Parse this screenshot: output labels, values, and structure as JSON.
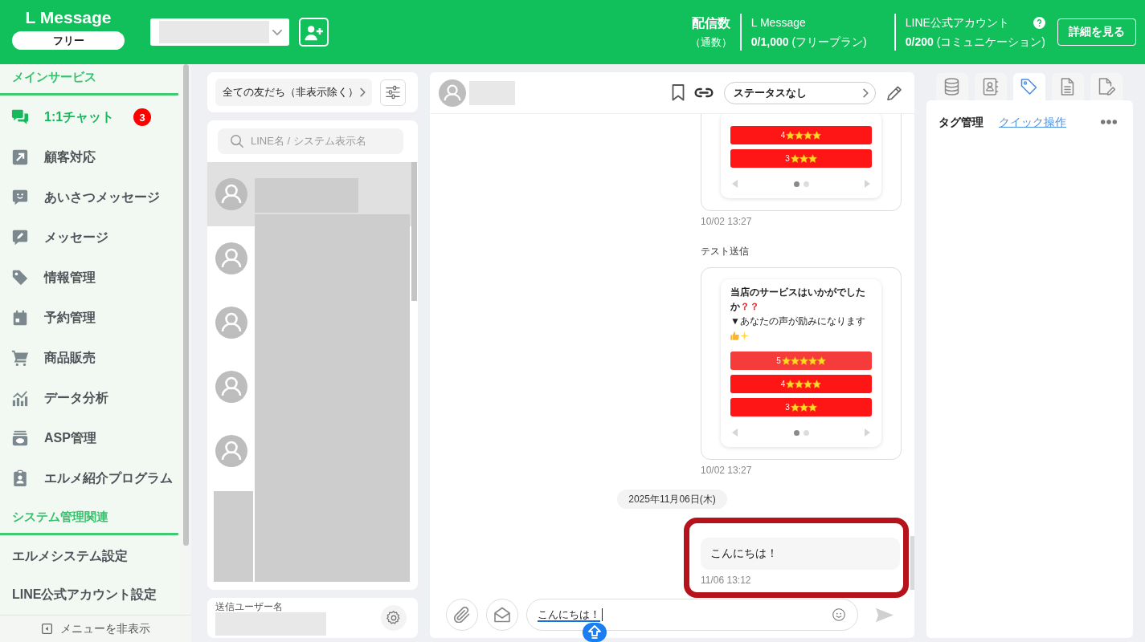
{
  "header": {
    "logo": "L Message",
    "plan": "フリー",
    "stats": {
      "title": "配信数",
      "subtitle": "（通数）"
    },
    "counters": [
      {
        "title": "L Message",
        "usage": "**0/1,000** (フリープラン)",
        "help": false
      },
      {
        "title": "LINE公式アカウント",
        "usage": "**0/200** (コミュニケーション)",
        "help": true
      }
    ],
    "details_button": "詳細を見る"
  },
  "sidebar": {
    "sections": [
      {
        "title": "メインサービス",
        "items": [
          {
            "label": "1:1チャット",
            "selected": true,
            "badge": "3"
          },
          {
            "label": "顧客対応",
            "selected": false
          },
          {
            "label": "あいさつメッセージ",
            "selected": false
          },
          {
            "label": "メッセージ",
            "selected": false
          },
          {
            "label": "情報管理",
            "selected": false
          },
          {
            "label": "予約管理",
            "selected": false
          },
          {
            "label": "商品販売",
            "selected": false
          },
          {
            "label": "データ分析",
            "selected": false
          },
          {
            "label": "ASP管理",
            "selected": false
          },
          {
            "label": "エルメ紹介プログラム",
            "selected": false
          }
        ]
      },
      {
        "title": "システム管理関連",
        "items": [
          {
            "label": "エルメシステム設定",
            "selected": false
          },
          {
            "label": "LINE公式アカウント設定",
            "selected": false
          }
        ]
      }
    ],
    "hide_menu": "メニューを非表示"
  },
  "friends_panel": {
    "filter": "全ての友だち（非表示除く）",
    "search": {
      "placeholder": "LINE名 / システム表示名"
    },
    "friends": [
      {
        "selected": true
      },
      {
        "selected": false
      },
      {
        "selected": false
      },
      {
        "selected": false
      },
      {
        "selected": false
      }
    ],
    "sender": {
      "label": "送信ユーザー名"
    }
  },
  "chat": {
    "status": "ステータスなし",
    "messages": [
      {
        "kind": "card",
        "buttons": [
          {
            "label": "4",
            "stars": 4,
            "color": "#fe1515"
          },
          {
            "label": "3",
            "stars": 3,
            "color": "#fe1515"
          }
        ],
        "pages": [
          {
            "selected": true
          },
          {
            "selected": false
          }
        ],
        "time": "10/02 13:27"
      },
      {
        "kind": "card",
        "caption": "テスト送信",
        "title": "当店のサービスはいかがでしたか",
        "title_emphasis": "？？",
        "body": "▼あなたの声が励みになります",
        "buttons": [
          {
            "label": "5",
            "stars": 5,
            "color": "#f63b3b"
          },
          {
            "label": "4",
            "stars": 4,
            "color": "#fe1515"
          },
          {
            "label": "3",
            "stars": 3,
            "color": "#fe1515"
          }
        ],
        "pages": [
          {
            "selected": true
          },
          {
            "selected": false
          }
        ],
        "time": "10/02 13:27"
      },
      {
        "kind": "date",
        "text": "2025年11月06日(木)"
      },
      {
        "kind": "text",
        "text": "こんにちは！",
        "time": "11/06 13:12",
        "highlighted": true
      }
    ],
    "composer": {
      "value": "こんにちは！",
      "composing": true
    }
  },
  "details_panel": {
    "tabs": [
      {
        "selected": false
      },
      {
        "selected": false
      },
      {
        "selected": true
      },
      {
        "selected": false
      },
      {
        "selected": false
      }
    ],
    "title": "タグ管理",
    "link": "クイック操作"
  }
}
